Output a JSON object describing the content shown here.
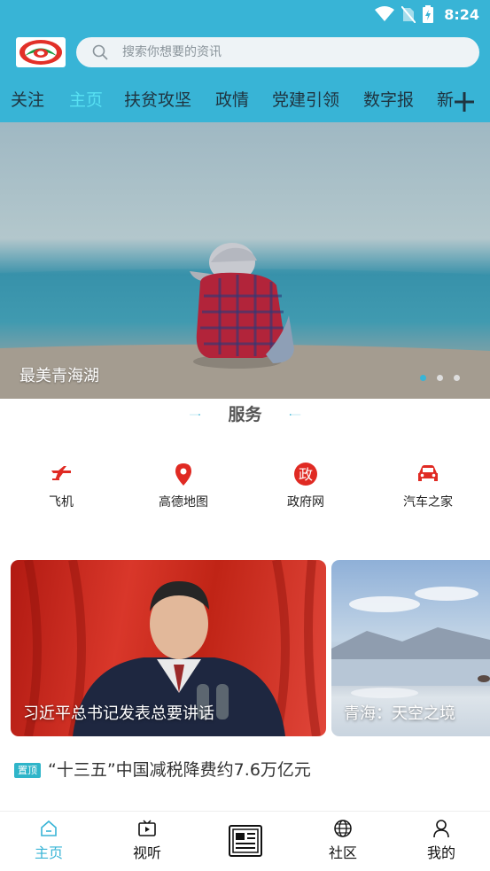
{
  "status_bar": {
    "time": "8:24"
  },
  "search": {
    "placeholder": "搜索你想要的资讯"
  },
  "tabs": [
    {
      "label": "关注"
    },
    {
      "label": "主页",
      "active": true
    },
    {
      "label": "扶贫攻坚"
    },
    {
      "label": "政情"
    },
    {
      "label": "党建引领"
    },
    {
      "label": "数字报"
    },
    {
      "label": "新"
    }
  ],
  "banner": {
    "caption": "最美青海湖",
    "slide_count": 3,
    "active_slide": 1
  },
  "services": {
    "title": "服务",
    "items": [
      {
        "label": "飞机",
        "icon": "airplane-icon"
      },
      {
        "label": "高德地图",
        "icon": "map-pin-icon"
      },
      {
        "label": "政府网",
        "icon": "government-icon",
        "glyph": "政"
      },
      {
        "label": "汽车之家",
        "icon": "car-icon"
      }
    ]
  },
  "cards": [
    {
      "caption": "习近平总书记发表总要讲话"
    },
    {
      "caption": "青海：天空之境"
    }
  ],
  "pinned": {
    "badge": "置顶",
    "title": "“十三五”中国减税降费约7.6万亿元"
  },
  "bottom_nav": [
    {
      "label": "主页",
      "icon": "home-icon",
      "active": true
    },
    {
      "label": "视听",
      "icon": "tv-icon"
    },
    {
      "label": "",
      "icon": "newspaper-icon"
    },
    {
      "label": "社区",
      "icon": "globe-icon"
    },
    {
      "label": "我的",
      "icon": "user-icon"
    }
  ],
  "colors": {
    "accent": "#38b4d6",
    "active_tab": "#57e0f2",
    "service_red": "#e02a23"
  }
}
